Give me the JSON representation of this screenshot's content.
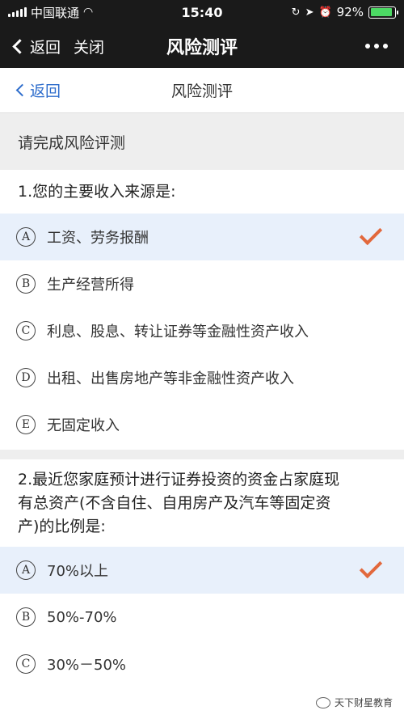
{
  "status_bar": {
    "carrier": "中国联通",
    "time": "15:40",
    "battery": "92%",
    "battery_level": 0.92
  },
  "nav_bar": {
    "back_label": "返回",
    "close_label": "关闭",
    "title": "风险测评"
  },
  "page_header": {
    "back_label": "返回",
    "title": "风险测评"
  },
  "banner": "请完成风险评测",
  "questions": [
    {
      "text": "1.您的主要收入来源是:",
      "options": [
        {
          "letter": "A",
          "text": "工资、劳务报酬",
          "selected": true
        },
        {
          "letter": "B",
          "text": "生产经营所得",
          "selected": false
        },
        {
          "letter": "C",
          "text": "利息、股息、转让证券等金融性资产收入",
          "selected": false
        },
        {
          "letter": "D",
          "text": "出租、出售房地产等非金融性资产收入",
          "selected": false
        },
        {
          "letter": "E",
          "text": "无固定收入",
          "selected": false
        }
      ]
    },
    {
      "text_lines": [
        "2.最近您家庭预计进行证券投资的资金占家庭现",
        "有总资产(不含自住、自用房产及汽车等固定资",
        "产)的比例是:"
      ],
      "options": [
        {
          "letter": "A",
          "text": "70%以上",
          "selected": true
        },
        {
          "letter": "B",
          "text": "50%-70%",
          "selected": false
        },
        {
          "letter": "C",
          "text": "30%－50%",
          "selected": false
        }
      ]
    }
  ],
  "watermark": "天下财星教育",
  "colors": {
    "accent_blue": "#2e6dcc",
    "check_orange": "#e2683c",
    "selected_bg": "#e8f0fb"
  }
}
